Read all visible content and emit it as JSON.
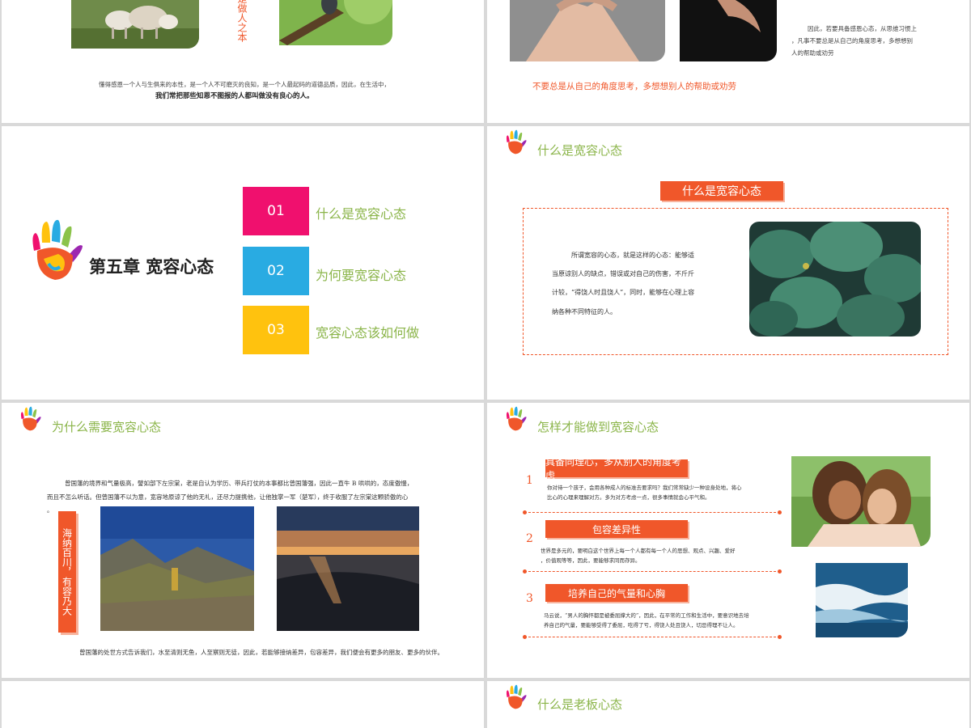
{
  "slide1": {
    "vertical_text": "就是做人之本",
    "line1": "懂得感恩一个人与生俱来的本性，是一个人不可磨灭的良知，是一个人最起码的道德品质，因此，在生活中，",
    "line2": "我们常把那些知恩不图报的人都叫做没有良心的人。"
  },
  "slide2": {
    "para_line1": "因此，若要具备感恩心态，从思维习惯上",
    "para_line2": "，凡事不要总是从自己的角度思考，多想想别",
    "para_line3": "人的帮助或劝劳",
    "highlight": "不要总是从自己的角度思考，多想想别人的帮助或劝劳"
  },
  "slide3": {
    "chapter_title": "第五章 宽容心态",
    "items": [
      {
        "num": "01",
        "label": "什么是宽容心态",
        "color": "#f0106e"
      },
      {
        "num": "02",
        "label": "为何要宽容心态",
        "color": "#29abe2"
      },
      {
        "num": "03",
        "label": "宽容心态该如何做",
        "color": "#ffc20e"
      }
    ]
  },
  "slide4": {
    "title": "什么是宽容心态",
    "tag": "什么是宽容心态",
    "lines": [
      "所谓宽容的心态，就是这样的心态：能够适",
      "当原谅别人的缺点，错误或对自己的伤害，不斤斤",
      "计较，“得饶人时且饶人”，同时，能够在心理上容",
      "纳各种不同特征的人。"
    ]
  },
  "slide5": {
    "title": "为什么需要宽容心态",
    "para_line1": "曾国藩的境界和气量极高，譬如部下左宗棠，老是自认为学历、带兵打仗的本事都比曾国藩强，因此一直牛 B 哄哄的，态度傲慢，",
    "para_line2": "而且不怎么听话。但曾国藩不以为意，宽容地原谅了他的无礼，还尽力提携他，让他独掌一军（楚军），终于收服了左宗棠这颗骄傲的心",
    "para_line3": "。",
    "vertical_tag": "海纳百川，有容乃大",
    "footer": "曾国藩的处世方式告诉我们，水至清则无鱼，人至察则无徒，因此，若能够接纳差异，包容差异，我们便会有更多的朋友、更多的伙伴。"
  },
  "slide6": {
    "title": "怎样才能做到宽容心态",
    "items": [
      {
        "num": "1",
        "tag": "具备同理心，多从别人的角度考虑",
        "line1": "你对待一个孩子，会用各种成人的标准去要求吗？我们常常缺少一种设身处地，将心",
        "line2": "比心的心理来理解对方。多为对方考虑一点，很多事情就会心平气和。"
      },
      {
        "num": "2",
        "tag": "包容差异性",
        "line1": "世界是多元的，要明白这个世界上每一个人都有每一个人的思想、观点、兴趣、爱好",
        "line2": "，价值观等等，因此，要能够求同而存异。"
      },
      {
        "num": "3",
        "tag": "培养自己的气量和心胸",
        "line1": "马云说，“男人的胸怀都是被委屈撑大的”，因此，在平常的工作和生活中，要意识地去培",
        "line2": "养自己的气量，要能够受得了委屈，吃得了亏，得饶人处且饶人，切忌得理不让人。"
      }
    ]
  },
  "slide8": {
    "title": "什么是老板心态"
  },
  "icons": {
    "hand": "painted-hand-icon"
  }
}
